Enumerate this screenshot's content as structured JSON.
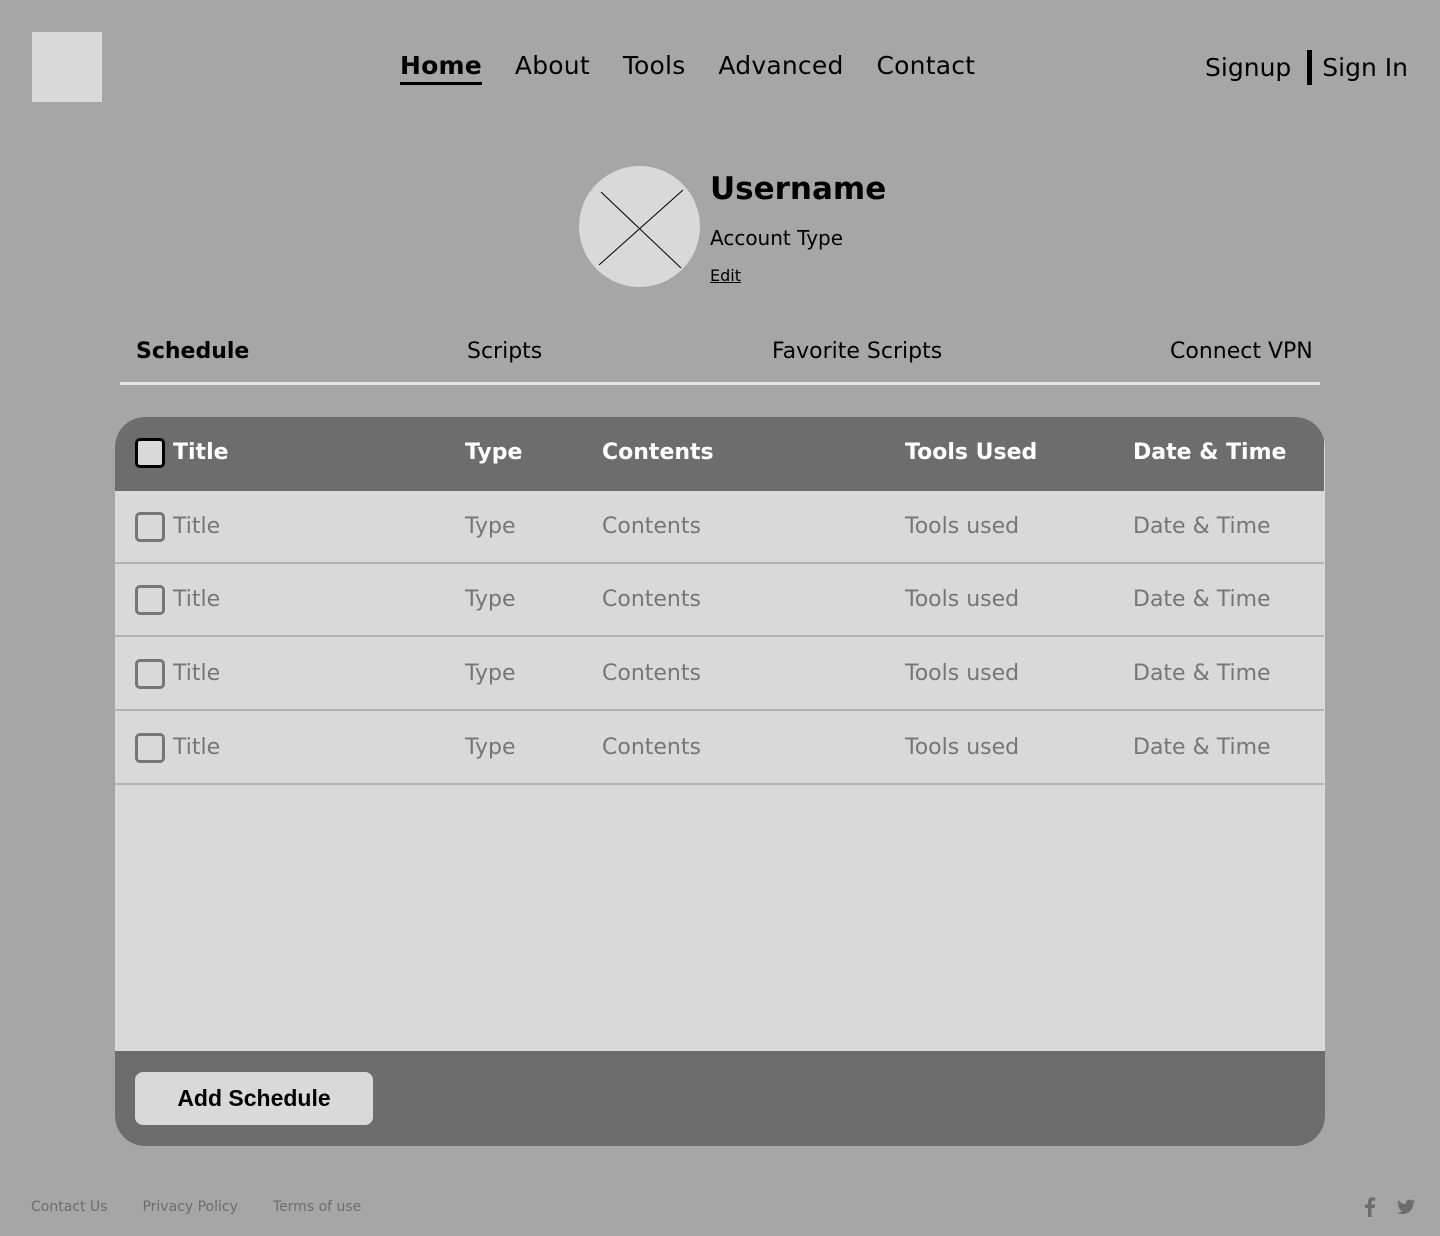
{
  "header": {
    "nav": [
      "Home",
      "About",
      "Tools",
      "Advanced",
      "Contact"
    ],
    "active_nav": "Home",
    "signup": "Signup",
    "signin": "Sign In"
  },
  "profile": {
    "username": "Username",
    "account_type": "Account Type",
    "edit": "Edit"
  },
  "tabs": {
    "items": [
      "Schedule",
      "Scripts",
      "Favorite Scripts",
      "Connect VPN"
    ],
    "active": "Schedule"
  },
  "table": {
    "columns": [
      "Title",
      "Type",
      "Contents",
      "Tools Used",
      "Date & Time"
    ],
    "rows": [
      [
        "Title",
        "Type",
        "Contents",
        "Tools used",
        "Date & Time"
      ],
      [
        "Title",
        "Type",
        "Contents",
        "Tools used",
        "Date & Time"
      ],
      [
        "Title",
        "Type",
        "Contents",
        "Tools used",
        "Date & Time"
      ],
      [
        "Title",
        "Type",
        "Contents",
        "Tools used",
        "Date & Time"
      ]
    ],
    "add_button": "Add Schedule"
  },
  "footer": {
    "links": [
      "Contact Us",
      "Privacy Policy",
      "Terms of use"
    ],
    "social": [
      "facebook-icon",
      "twitter-icon"
    ]
  },
  "colors": {
    "background": "#a6a6a6",
    "surface": "#d9d9d9",
    "header_bar": "#6d6d6d",
    "muted_text": "#767676"
  }
}
